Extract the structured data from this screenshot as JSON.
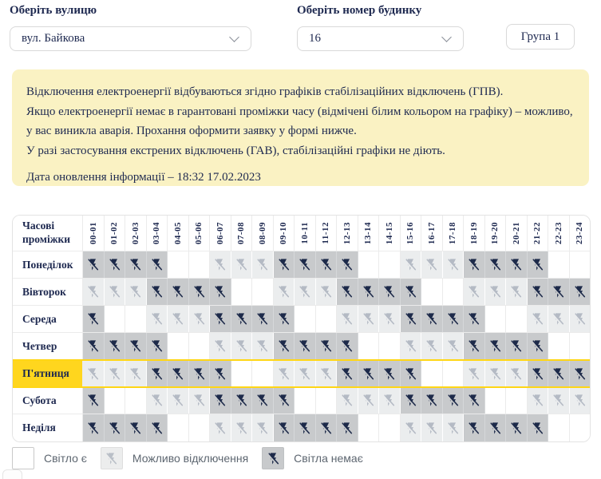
{
  "controls": {
    "street_label": "Оберіть вулицю",
    "street_value": "вул. Байкова",
    "building_label": "Оберіть номер будинку",
    "building_value": "16",
    "group_badge": "Група 1"
  },
  "notice": {
    "line1": "Відключення електроенергії відбуваються згідно графіків стабілізаційних відключень (ГПВ).",
    "line2": "Якщо електроенергії немає в гарантовані проміжки часу (відмічені білим кольором на графіку) – можливо, у вас виникла аварія. Прохання оформити заявку у формі нижче.",
    "line3": "У разі застосування екстрених відключень (ГАВ), стабілізаційні графіки не діють.",
    "updated": "Дата оновлення інформації – 18:32 17.02.2023"
  },
  "schedule": {
    "corner_label": "Часові проміжки",
    "time_slots": [
      "00-01",
      "01-02",
      "02-03",
      "03-04",
      "04-05",
      "05-06",
      "06-07",
      "07-08",
      "08-09",
      "09-10",
      "10-11",
      "11-12",
      "12-13",
      "13-14",
      "14-15",
      "15-16",
      "16-17",
      "17-18",
      "18-19",
      "19-20",
      "20-21",
      "21-22",
      "22-23",
      "23-24"
    ],
    "cell_codes": {
      "W": "light-on",
      "M": "possible-outage",
      "D": "no-light"
    },
    "rows": [
      {
        "day": "Понеділок",
        "highlight": false,
        "cells": "DDDDWWMMMDDDDWWMMMDDDDWW"
      },
      {
        "day": "Вівторок",
        "highlight": false,
        "cells": "MMMDDDDWWMMMDDDDWWMMMDDD"
      },
      {
        "day": "Середа",
        "highlight": false,
        "cells": "DWWMMMDDDDWWMMMDDDDWWMMM"
      },
      {
        "day": "Четвер",
        "highlight": false,
        "cells": "DDDDWWMMMDDDDWWMMMDDDDWW"
      },
      {
        "day": "П'ятниця",
        "highlight": true,
        "cells": "MMMDDDDWWMMMDDDDWWMMMDDD"
      },
      {
        "day": "Субота",
        "highlight": false,
        "cells": "DWWMMMDDDDWWMMMDDDDWWMMM"
      },
      {
        "day": "Неділя",
        "highlight": false,
        "cells": "DDDDWWMMMDDDDWWMMMDDDDWW"
      }
    ],
    "legend": [
      {
        "key": "on",
        "label": "Світло є"
      },
      {
        "key": "maybe",
        "label": "Можливо відключення"
      },
      {
        "key": "off",
        "label": "Світла немає"
      }
    ]
  },
  "colors": {
    "text_navy": "#1e2950",
    "notice_bg": "#faf2c3",
    "highlight_yellow": "#ffd615",
    "cell_no_light_bg": "#c8cacc",
    "cell_possible_bg": "#ebedee",
    "icon_dark": "#1d2a4a",
    "icon_light": "#b4bac4",
    "border_gray": "#d9d9d9",
    "legend_text": "#5d6670"
  }
}
